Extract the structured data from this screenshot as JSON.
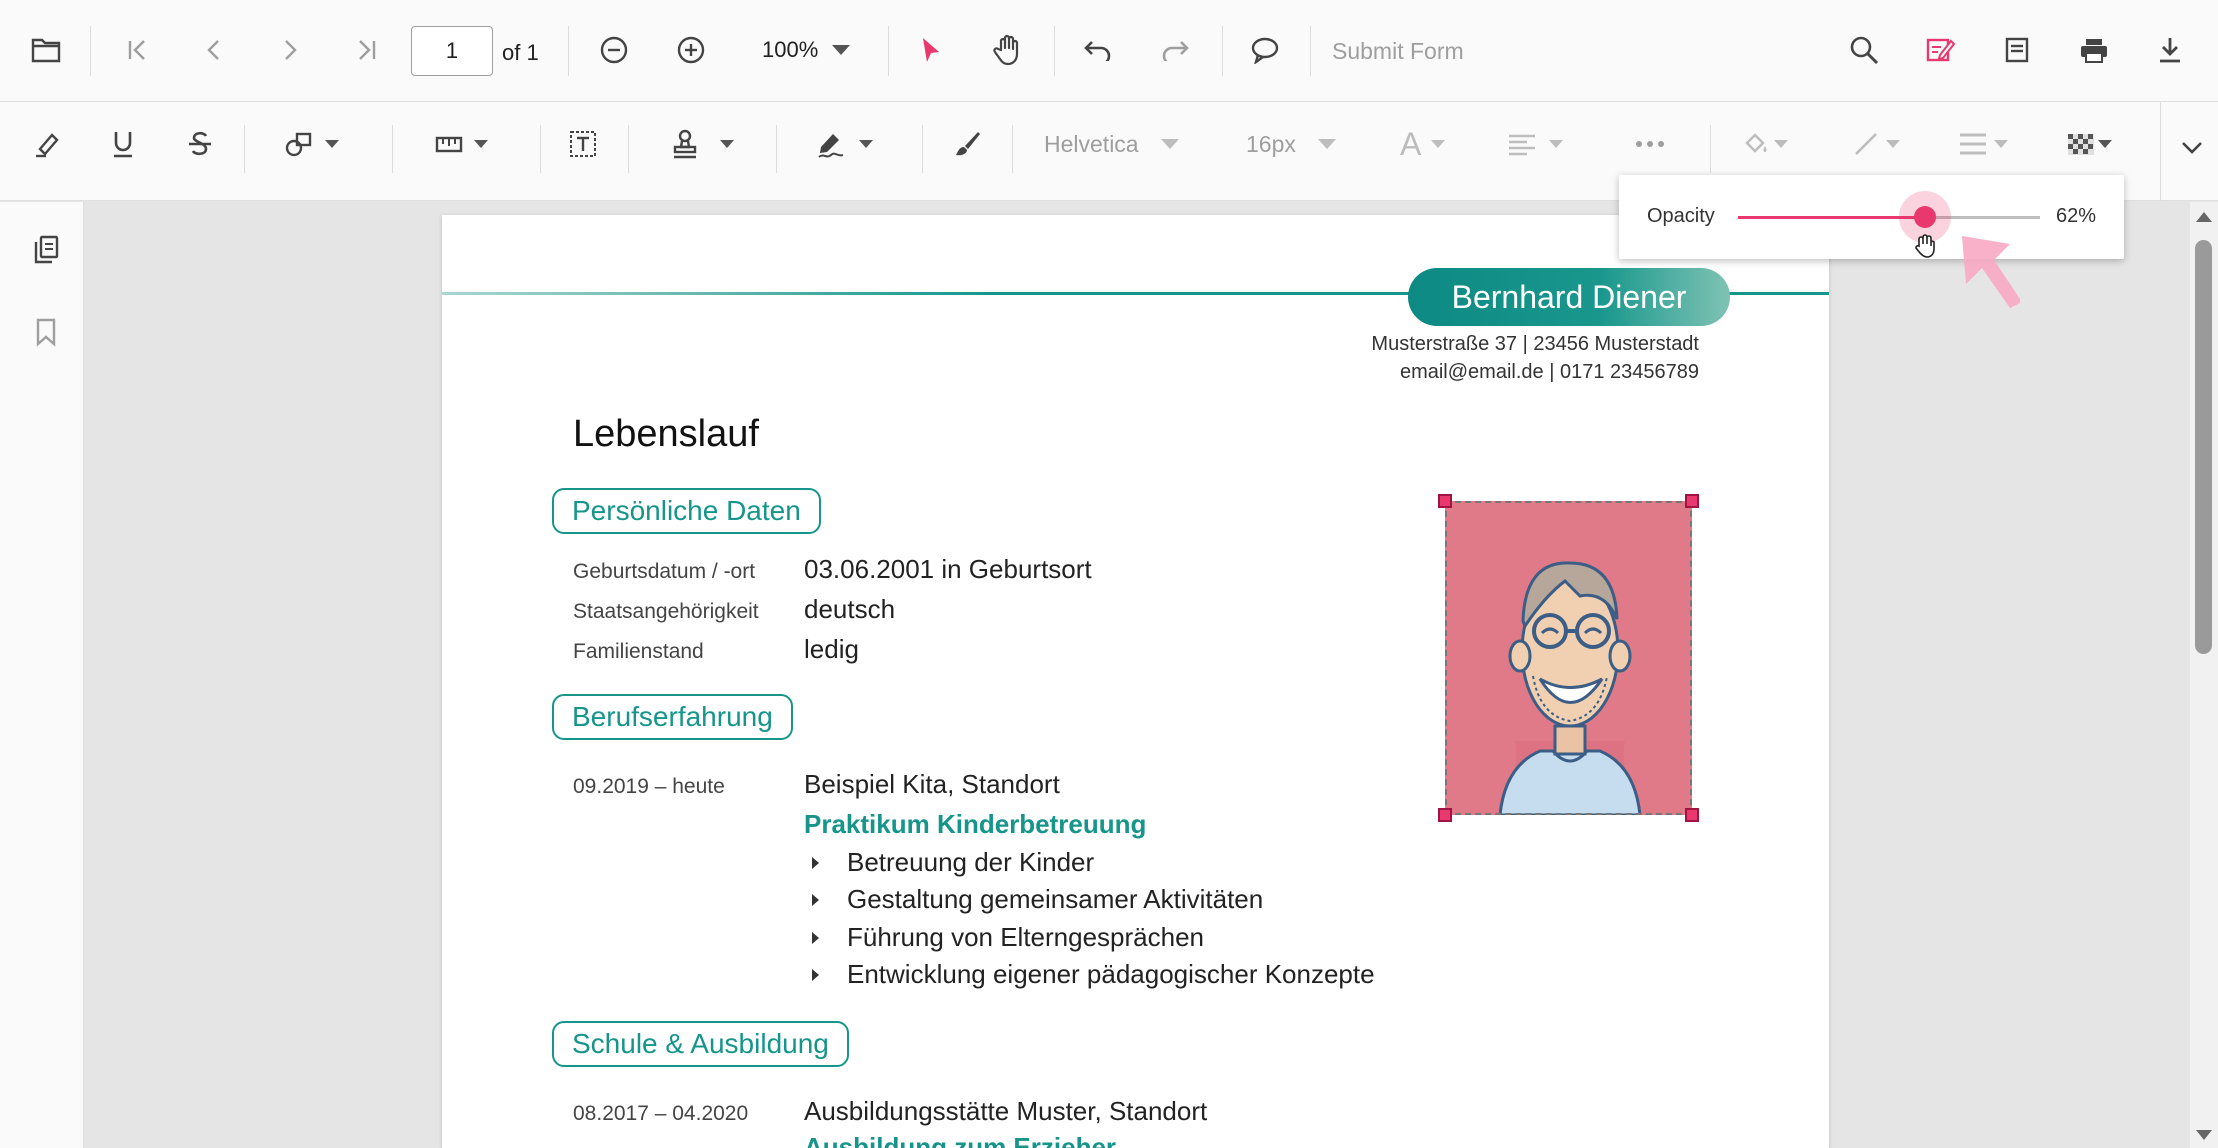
{
  "toolbar": {
    "page_current": "1",
    "page_of": "of 1",
    "zoom": "100%",
    "submit_form": "Submit Form"
  },
  "annotation_toolbar": {
    "font_family": "Helvetica",
    "font_size": "16px",
    "font_color_glyph": "A"
  },
  "opacity_popup": {
    "label": "Opacity",
    "value_text": "62%",
    "value": 0.62
  },
  "document": {
    "name": "Bernhard Diener",
    "address": "Musterstraße 37 | 23456 Musterstadt",
    "contact": "email@email.de | 0171 23456789",
    "title": "Lebenslauf",
    "sections": {
      "personal": "Persönliche Daten",
      "experience": "Berufserfahrung",
      "education": "Schule & Ausbildung"
    },
    "personal": [
      {
        "label": "Geburtsdatum / -ort",
        "value": "03.06.2001 in Geburtsort"
      },
      {
        "label": "Staatsangehörigkeit",
        "value": "deutsch"
      },
      {
        "label": "Familienstand",
        "value": "ledig"
      }
    ],
    "experience": {
      "date": "09.2019 – heute",
      "employer": "Beispiel Kita, Standort",
      "role": "Praktikum Kinderbetreuung",
      "bullets": [
        "Betreuung der Kinder",
        "Gestaltung gemeinsamer Aktivitäten",
        "Führung von Elterngesprächen",
        "Entwicklung eigener pädagogischer Konzepte"
      ]
    },
    "education": {
      "date": "08.2017 – 04.2020",
      "institution": "Ausbildungsstätte Muster, Standort",
      "degree": "Ausbildung zum Erzieher"
    }
  },
  "colors": {
    "accent": "#e8386d",
    "teal": "#16958b",
    "photo_bg": "#e07a88"
  }
}
